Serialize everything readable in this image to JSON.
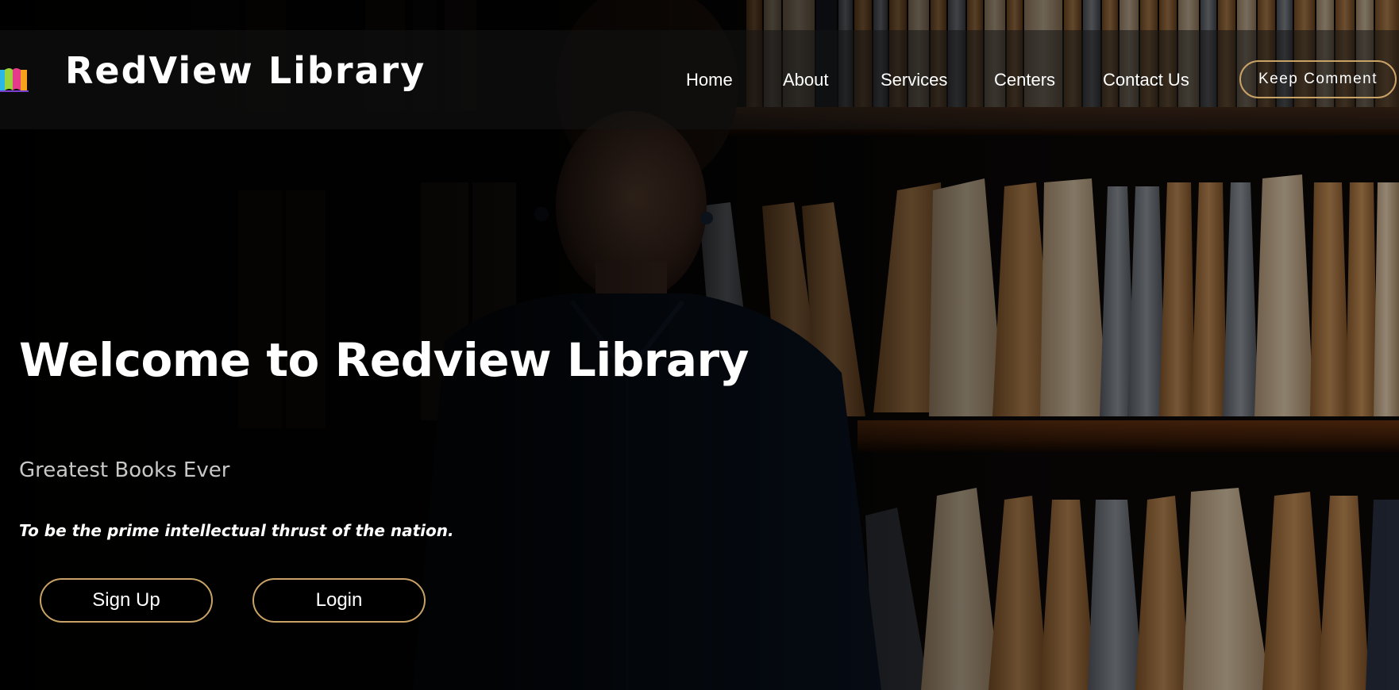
{
  "brand": {
    "name": "RedView Library",
    "logo_icon": "books-icon"
  },
  "nav": {
    "items": [
      {
        "label": "Home"
      },
      {
        "label": "About"
      },
      {
        "label": "Services"
      },
      {
        "label": "Centers"
      },
      {
        "label": "Contact Us"
      }
    ],
    "keep_comment_label": "Keep Comment"
  },
  "hero": {
    "title": "Welcome to Redview Library",
    "subtitle": "Greatest Books Ever",
    "motto": "To be the prime intellectual thrust of the nation.",
    "signup_label": "Sign Up",
    "login_label": "Login"
  },
  "colors": {
    "button_border": "#c9a266",
    "text_primary": "#ffffff",
    "subtitle": "#c8c8c8"
  }
}
